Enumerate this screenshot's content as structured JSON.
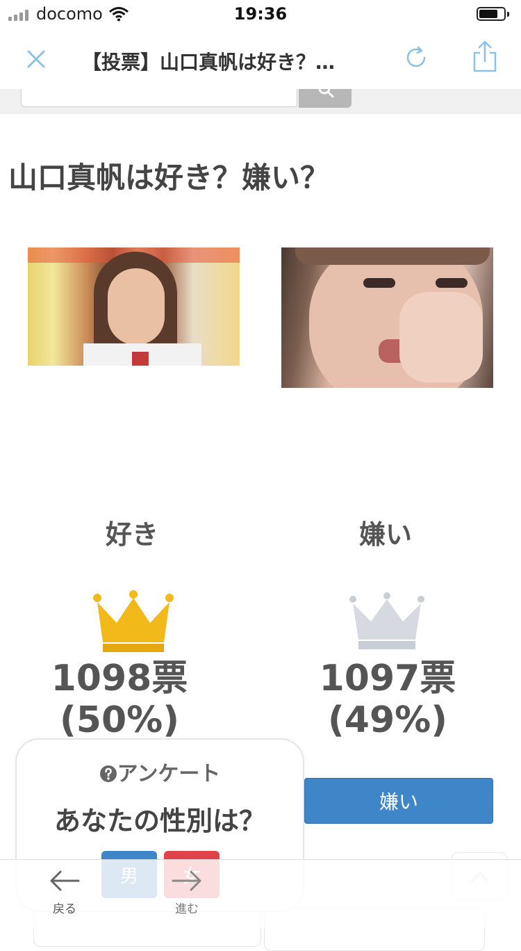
{
  "status_bar": {
    "carrier": "docomo",
    "time": "19:36"
  },
  "nav": {
    "title": "【投票】山口真帆は好き？…"
  },
  "page": {
    "heading": "山口真帆は好き？嫌い？"
  },
  "candidates": [
    {
      "name": "好き",
      "votes": "1098票",
      "percent": "(50%)",
      "crown_color": "#f2b91a"
    },
    {
      "name": "嫌い",
      "votes": "1097票",
      "percent": "(49%)",
      "crown_color": "#c9ced6",
      "button_label": "嫌い"
    }
  ],
  "survey": {
    "label": "アンケート",
    "question": "あなたの性別は？",
    "options": [
      "男",
      "女"
    ]
  },
  "toolbar": {
    "back_label": "戻る",
    "forward_label": "進む"
  },
  "colors": {
    "accent": "#3f86c9",
    "nav_icon": "#8ec1e6",
    "male": "#3f86c9",
    "female": "#e0434a"
  },
  "icons": [
    "close-icon",
    "reload-icon",
    "share-icon",
    "search-icon",
    "crown-icon",
    "question-icon",
    "arrow-left-icon",
    "arrow-right-icon",
    "chevron-up-icon"
  ]
}
